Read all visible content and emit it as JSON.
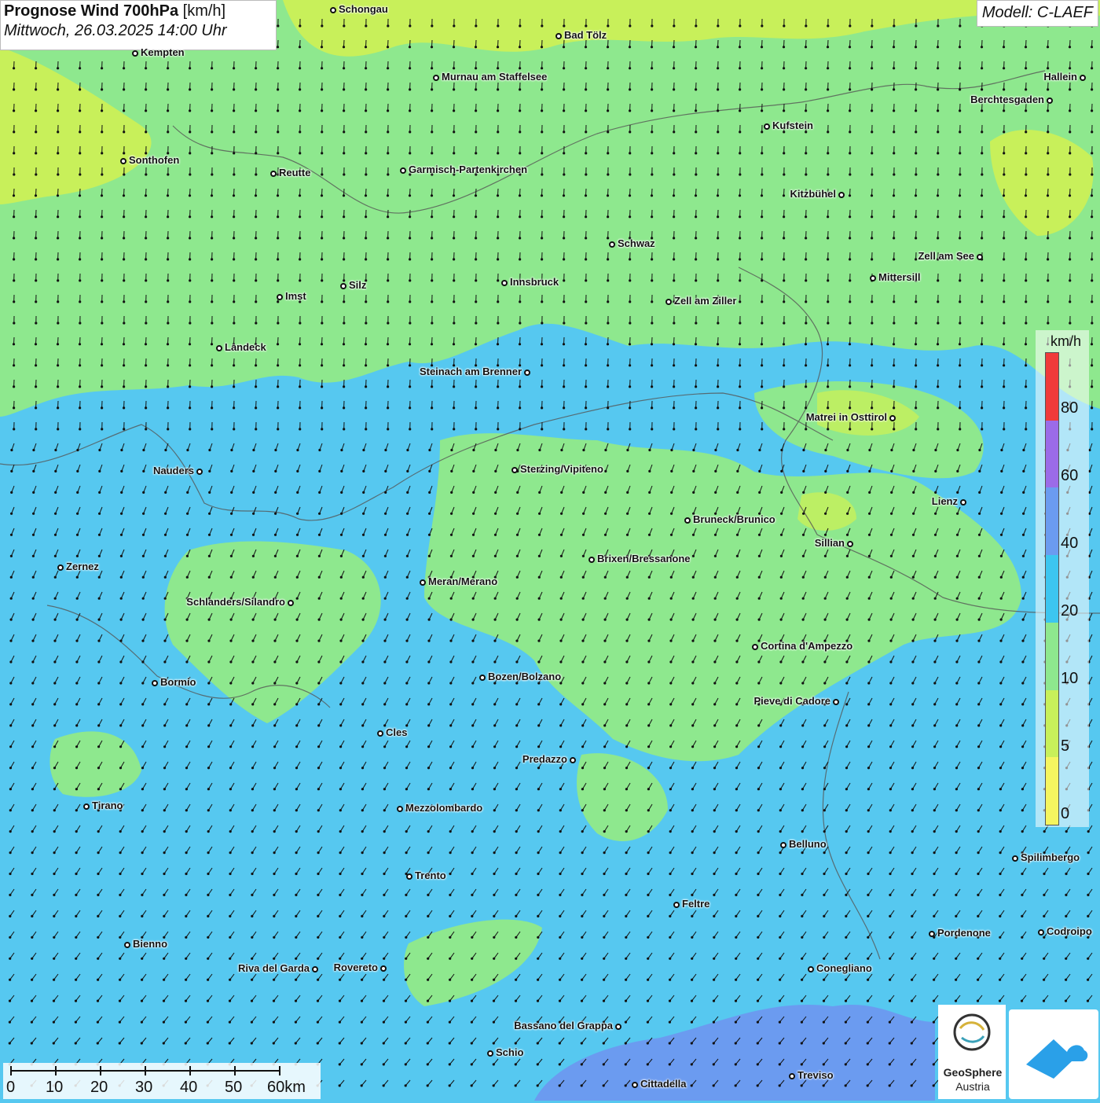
{
  "header": {
    "title_main": "Prognose Wind 700hPa",
    "title_unit": "[km/h]",
    "subtitle": "Mittwoch, 26.03.2025 14:00 Uhr",
    "model": "Modell: C-LAEF"
  },
  "legend": {
    "unit": "km/h",
    "ticks": [
      "80",
      "60",
      "40",
      "20",
      "10",
      "5",
      "0"
    ],
    "colors": [
      "#f03a3a",
      "#9b6be8",
      "#6b9bf0",
      "#3cc6f0",
      "#8ee88e",
      "#c8f05a",
      "#f5f560"
    ]
  },
  "scalebar": {
    "labels": [
      "0",
      "10",
      "20",
      "30",
      "40",
      "50",
      "60km"
    ]
  },
  "logos": {
    "geosphere_line1": "GeoSphere",
    "geosphere_line2": "Austria"
  },
  "cities": [
    {
      "name": "Schongau",
      "label_side": "right"
    },
    {
      "name": "Bad Tölz",
      "label_side": "right"
    },
    {
      "name": "Kempten",
      "label_side": "right"
    },
    {
      "name": "Murnau am Staffelsee",
      "label_side": "right"
    },
    {
      "name": "Hallein",
      "label_side": "left"
    },
    {
      "name": "Berchtesgaden",
      "label_side": "left"
    },
    {
      "name": "Kufstein",
      "label_side": "right"
    },
    {
      "name": "Sonthofen",
      "label_side": "right"
    },
    {
      "name": "Reutte",
      "label_side": "right"
    },
    {
      "name": "Garmisch-Partenkirchen",
      "label_side": "right"
    },
    {
      "name": "Kitzbühel",
      "label_side": "left"
    },
    {
      "name": "Schwaz",
      "label_side": "right"
    },
    {
      "name": "Zell am See",
      "label_side": "left"
    },
    {
      "name": "Mittersill",
      "label_side": "right"
    },
    {
      "name": "Innsbruck",
      "label_side": "right"
    },
    {
      "name": "Silz",
      "label_side": "right"
    },
    {
      "name": "Imst",
      "label_side": "right"
    },
    {
      "name": "Zell am Ziller",
      "label_side": "right"
    },
    {
      "name": "Landeck",
      "label_side": "right"
    },
    {
      "name": "Steinach am Brenner",
      "label_side": "left"
    },
    {
      "name": "Matrei in Osttirol",
      "label_side": "left"
    },
    {
      "name": "Nauders",
      "label_side": "left"
    },
    {
      "name": "Sterzing/Vipiteno",
      "label_side": "right"
    },
    {
      "name": "Lienz",
      "label_side": "left"
    },
    {
      "name": "Bruneck/Brunico",
      "label_side": "right"
    },
    {
      "name": "Sillian",
      "label_side": "left"
    },
    {
      "name": "Zernez",
      "label_side": "right"
    },
    {
      "name": "Brixen/Bressanone",
      "label_side": "right"
    },
    {
      "name": "Meran/Merano",
      "label_side": "right"
    },
    {
      "name": "Schlanders/Silandro",
      "label_side": "left"
    },
    {
      "name": "Cortina d'Ampezzo",
      "label_side": "right"
    },
    {
      "name": "Bozen/Bolzano",
      "label_side": "right"
    },
    {
      "name": "Bormio",
      "label_side": "right"
    },
    {
      "name": "Pieve di Cadore",
      "label_side": "left"
    },
    {
      "name": "Cles",
      "label_side": "right"
    },
    {
      "name": "Predazzo",
      "label_side": "left"
    },
    {
      "name": "Tirano",
      "label_side": "right"
    },
    {
      "name": "Mezzolombardo",
      "label_side": "right"
    },
    {
      "name": "Belluno",
      "label_side": "right"
    },
    {
      "name": "Spilimbergo",
      "label_side": "right"
    },
    {
      "name": "Trento",
      "label_side": "right"
    },
    {
      "name": "Feltre",
      "label_side": "right"
    },
    {
      "name": "Pordenone",
      "label_side": "right"
    },
    {
      "name": "Codroipo",
      "label_side": "right"
    },
    {
      "name": "Bienno",
      "label_side": "right"
    },
    {
      "name": "Riva del Garda",
      "label_side": "left"
    },
    {
      "name": "Rovereto",
      "label_side": "left"
    },
    {
      "name": "Conegliano",
      "label_side": "right"
    },
    {
      "name": "Bassano del Grappa",
      "label_side": "left"
    },
    {
      "name": "Schio",
      "label_side": "right"
    },
    {
      "name": "Treviso",
      "label_side": "right"
    },
    {
      "name": "Cittadella",
      "label_side": "right"
    }
  ]
}
